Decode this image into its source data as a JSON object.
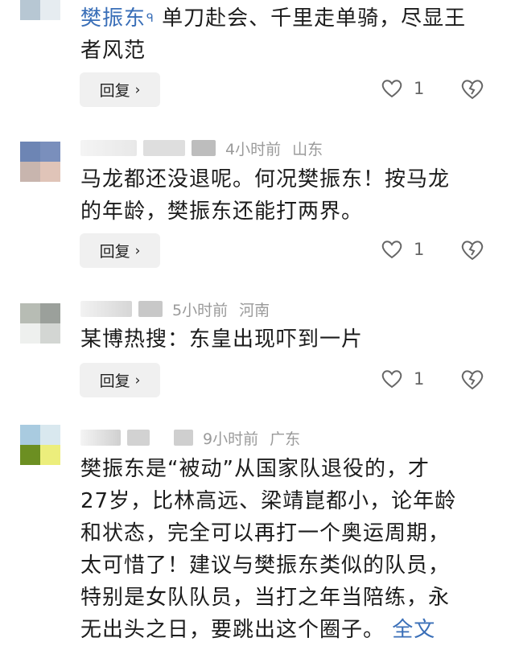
{
  "comments": [
    {
      "author": "樊振东",
      "search_glyph": "🔍",
      "text": "单刀赴会、千里走单骑，尽显王者风范",
      "reply_label": "回复",
      "likes": "1",
      "avatar_colors": [
        "#3f6f98",
        "#8aa6ba",
        "#b7c7d3",
        "#e6ecf0"
      ]
    },
    {
      "time": "4小时前",
      "location": "山东",
      "text_line1": "马龙都还没退呢。何况樊振东！按马龙",
      "text_line2": "的年龄，樊振东还能打两界。",
      "reply_label": "回复",
      "likes": "1",
      "avatar_colors": [
        "#6d85b4",
        "#7a8fbc",
        "#c8b5ae",
        "#e0c4b8"
      ]
    },
    {
      "time": "5小时前",
      "location": "河南",
      "text": "某博热搜：东皇出现吓到一片",
      "reply_label": "回复",
      "likes": "1",
      "avatar_colors": [
        "#b7bcb4",
        "#9ba09b",
        "#eef0ee",
        "#d3d6d3"
      ]
    },
    {
      "time": "9小时前",
      "location": "广东",
      "text_lines": [
        "樊振东是“被动”从国家队退役的，才",
        "27岁，比林高远、梁靖崑都小，论年龄",
        "和状态，完全可以再打一个奥运周期，",
        "太可惜了！建议与樊振东类似的队员，",
        "特别是女队队员，当打之年当陪练，永",
        "无出头之日，要跳出这个圈子。"
      ],
      "fulltext_label": "全文",
      "avatar_colors": [
        "#a9cbe0",
        "#d9e8ef",
        "#6c8f22",
        "#ecee7c"
      ]
    }
  ],
  "icons": {
    "like": "heart-outline-icon",
    "dislike": "broken-heart-icon",
    "reply_chevron": "chevron-right-icon"
  }
}
